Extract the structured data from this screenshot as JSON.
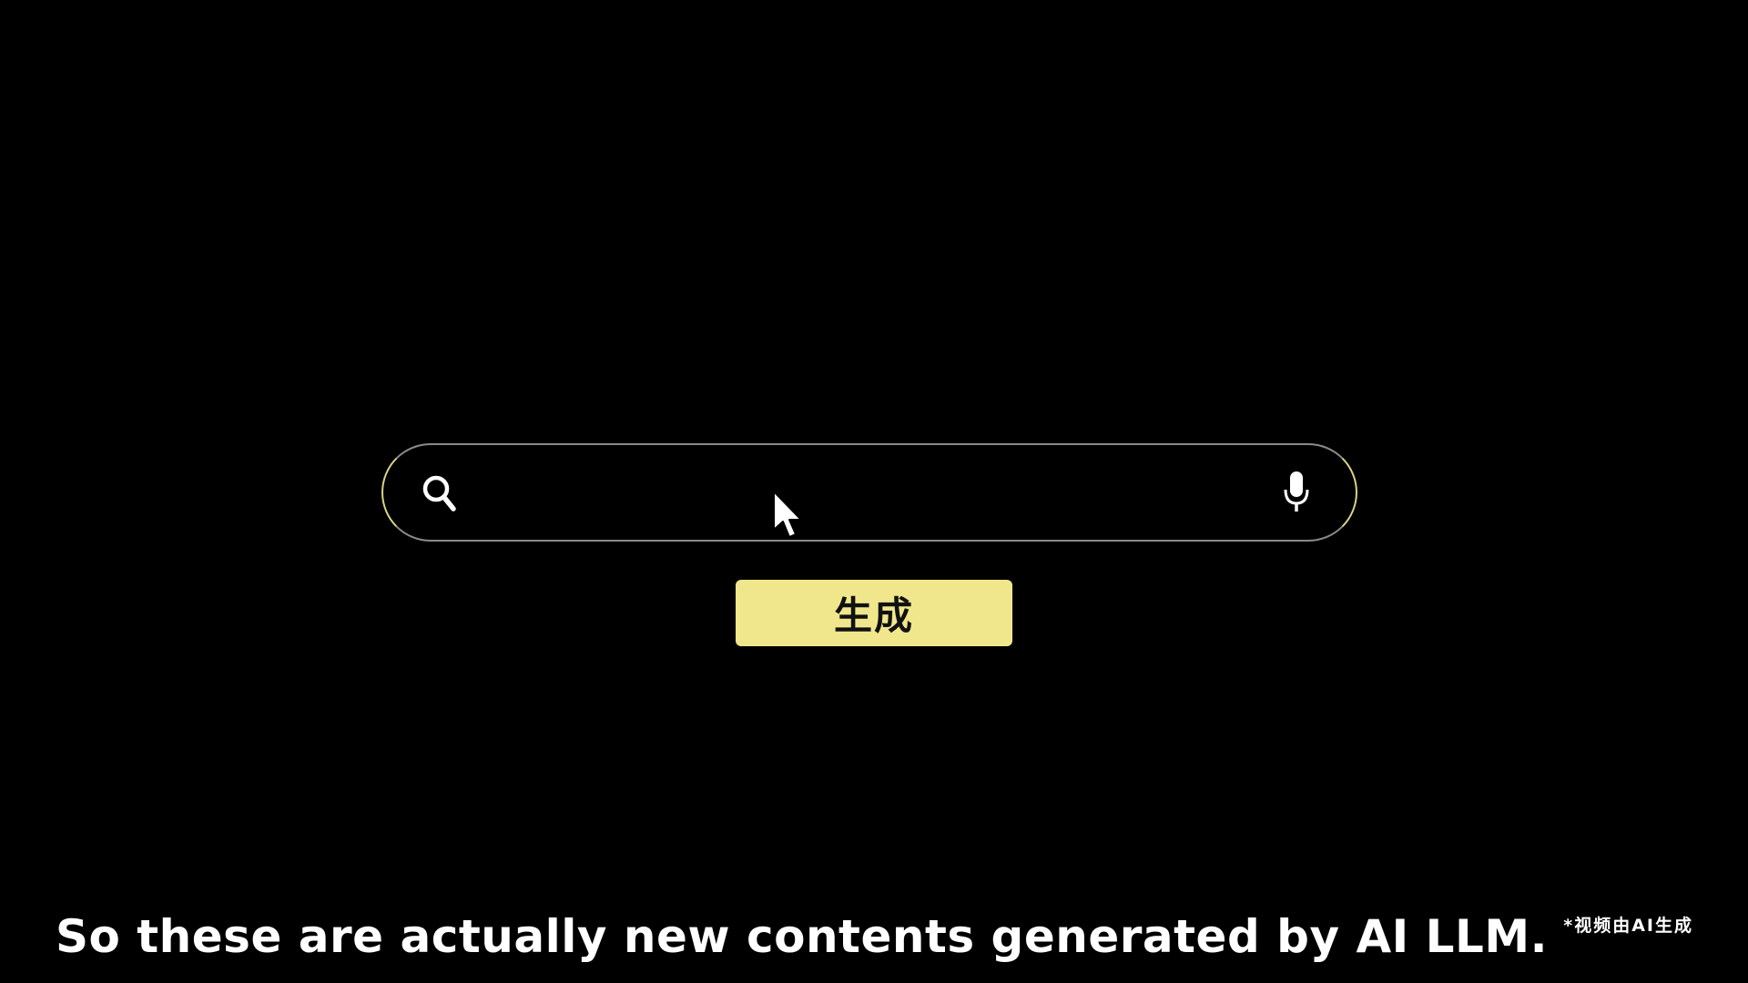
{
  "search": {
    "value": "",
    "placeholder": "",
    "search_icon": "search-icon",
    "mic_icon": "microphone-icon"
  },
  "generate_button": {
    "label": "生成"
  },
  "subtitle": {
    "text": "So these are actually new contents generated by AI LLM."
  },
  "watermark": {
    "text": "*视频由AI生成"
  },
  "colors": {
    "background": "#000000",
    "button_background": "#f0e68c",
    "search_border": "#8a8a8a",
    "search_border_accent": "#d8d28a",
    "text": "#ffffff"
  }
}
